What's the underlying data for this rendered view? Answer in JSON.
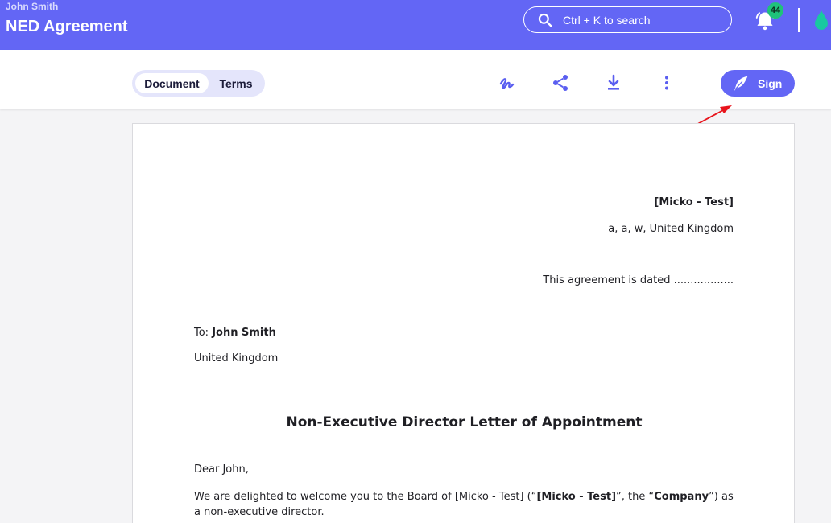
{
  "header": {
    "user_name": "John Smith",
    "title": "NED Agreement",
    "search_placeholder": "Ctrl + K to search",
    "notification_count": "44",
    "search_icon": "search-icon",
    "bell_icon": "bell-icon",
    "drop_icon": "water-drop-icon"
  },
  "toolbar": {
    "tabs": [
      {
        "label": "Document",
        "active": true
      },
      {
        "label": "Terms",
        "active": false
      }
    ],
    "tools": [
      "signature-icon",
      "share-icon",
      "download-icon",
      "more-vertical-icon"
    ],
    "sign_label": "Sign",
    "sign_icon": "feather-pen-icon"
  },
  "document": {
    "company_name": "[Micko - Test]",
    "company_address": "a, a, w, United Kingdom",
    "dated_line": "This agreement is dated ..................",
    "to_label": "To:",
    "to_name": "John Smith",
    "to_country": "United Kingdom",
    "heading": "Non-Executive Director Letter of Appointment",
    "greeting": "Dear John,",
    "paragraph": {
      "part1": "We are delighted to welcome you to the Board of [Micko - Test] (“",
      "bold1": "[Micko - Test]",
      "part2": "”, the “",
      "bold2": "Company",
      "part3": "”) as a non-executive director."
    }
  },
  "colors": {
    "brand": "#6366f5",
    "badge": "#1fc27a",
    "drop": "#19c9a0",
    "annotation_arrow": "#e8141c"
  }
}
